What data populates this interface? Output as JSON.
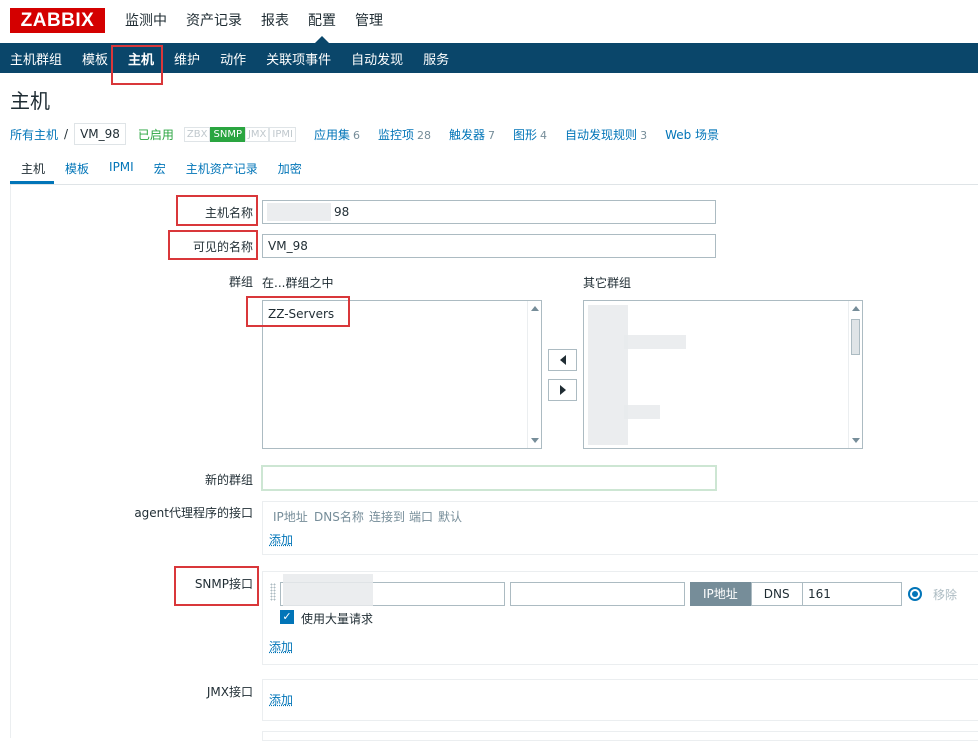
{
  "brand": {
    "logo": "ZABBIX",
    "color": "#d40000",
    "nav_color": "#0a466a",
    "link_color": "#0275b8"
  },
  "main_menu": [
    {
      "label": "监测中"
    },
    {
      "label": "资产记录"
    },
    {
      "label": "报表"
    },
    {
      "label": "配置",
      "active": true
    },
    {
      "label": "管理"
    }
  ],
  "sub_menu": [
    {
      "label": "主机群组"
    },
    {
      "label": "模板"
    },
    {
      "label": "主机",
      "active": true
    },
    {
      "label": "维护"
    },
    {
      "label": "动作"
    },
    {
      "label": "关联项事件"
    },
    {
      "label": "自动发现"
    },
    {
      "label": "服务"
    }
  ],
  "page": {
    "title": "主机"
  },
  "breadcrumb": {
    "all_hosts": "所有主机",
    "separator": "/",
    "current": "VM_98",
    "status": "已启用",
    "availability": [
      "ZBX",
      "SNMP",
      "JMX",
      "IPMI"
    ],
    "links": [
      {
        "label": "应用集",
        "count": "6"
      },
      {
        "label": "监控项",
        "count": "28"
      },
      {
        "label": "触发器",
        "count": "7"
      },
      {
        "label": "图形",
        "count": "4"
      },
      {
        "label": "自动发现规则",
        "count": "3"
      },
      {
        "label": "Web 场景",
        "count": ""
      }
    ]
  },
  "tabs": [
    {
      "label": "主机",
      "active": true
    },
    {
      "label": "模板"
    },
    {
      "label": "IPMI"
    },
    {
      "label": "宏"
    },
    {
      "label": "主机资产记录"
    },
    {
      "label": "加密"
    }
  ],
  "form": {
    "host_name_label": "主机名称",
    "host_name_value": "98",
    "visible_name_label": "可见的名称",
    "visible_name_value": "VM_98",
    "groups_label": "群组",
    "in_groups_label": "在...群组之中",
    "other_groups_label": "其它群组",
    "in_groups": [
      "ZZ-Servers"
    ],
    "new_group_label": "新的群组",
    "new_group_value": "",
    "agent_iface_label": "agent代理程序的接口",
    "iface_headers": [
      "IP地址",
      "DNS名称",
      "连接到",
      "端口",
      "默认"
    ],
    "add_label": "添加",
    "snmp_iface_label": "SNMP接口",
    "snmp": {
      "ip": "",
      "dns": "",
      "connect_ip": "IP地址",
      "connect_dns": "DNS",
      "port": "161",
      "remove": "移除",
      "bulk_label": "使用大量请求",
      "bulk_checked": true
    },
    "jmx_iface_label": "JMX接口"
  }
}
